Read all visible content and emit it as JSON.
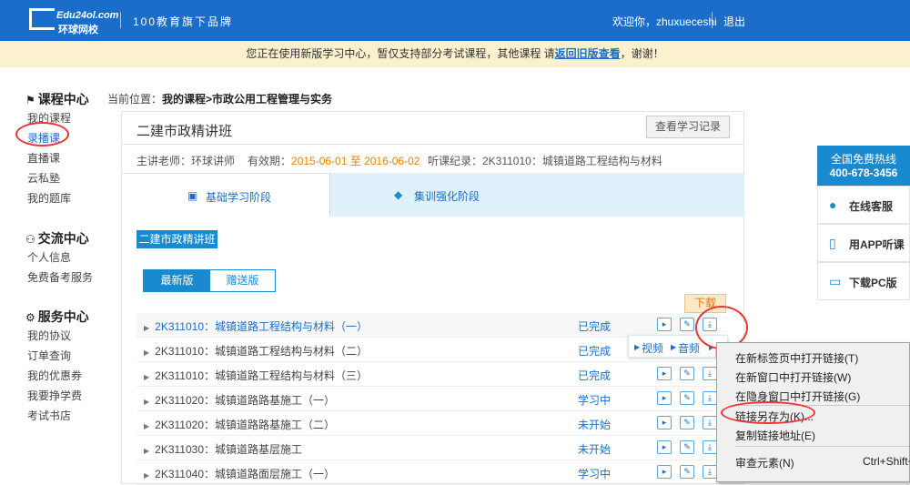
{
  "header": {
    "logo_line1": "Edu24ol.com",
    "logo_line2": "环球网校",
    "tagline": "100教育旗下品牌",
    "welcome": "欢迎你，zhuxueceshi",
    "logout": "退出"
  },
  "notice": {
    "prefix": "您正在使用新版学习中心，暂仅支持部分考试课程，其他课程 请",
    "link": "返回旧版查看",
    "suffix": "，谢谢！"
  },
  "sidebar": {
    "course_center": {
      "title": "课程中心",
      "items": [
        "我的课程",
        "录播课",
        "直播课",
        "云私塾",
        "我的题库"
      ]
    },
    "exchange_center": {
      "title": "交流中心",
      "items": [
        "个人信息",
        "免费备考服务"
      ]
    },
    "service_center": {
      "title": "服务中心",
      "items": [
        "我的协议",
        "订单查询",
        "我的优惠券",
        "我要挣学费",
        "考试书店"
      ]
    }
  },
  "breadcrumb": {
    "label": "当前位置：",
    "path": "我的课程>市政公用工程管理与实务"
  },
  "course": {
    "title": "二建市政精讲班",
    "record_button": "查看学习记录",
    "teacher": "主讲老师：环球讲师",
    "validity_label": "有效期：",
    "validity_dates": "2015-06-01 至 2016-06-02",
    "last_listen": "听课纪录：2K311010：城镇道路工程结构与材料",
    "stage_tabs": [
      "基础学习阶段",
      "集训强化阶段"
    ],
    "class_button": "二建市政精讲班",
    "version_tabs": [
      "最新版",
      "赠送版"
    ],
    "lessons": [
      {
        "title": "2K311010：城镇道路工程结构与材料（一）",
        "status": "已完成"
      },
      {
        "title": "2K311010：城镇道路工程结构与材料（二）",
        "status": "已完成"
      },
      {
        "title": "2K311010：城镇道路工程结构与材料（三）",
        "status": "已完成"
      },
      {
        "title": "2K311020：城镇道路路基施工（一）",
        "status": "学习中"
      },
      {
        "title": "2K311020：城镇道路路基施工（二）",
        "status": "未开始"
      },
      {
        "title": "2K311030：城镇道路基层施工",
        "status": "未开始"
      },
      {
        "title": "2K311040：城镇道路面层施工（一）",
        "status": "学习中"
      }
    ]
  },
  "download_tooltip": "下载",
  "sub_menu": {
    "video": "视频",
    "audio": "音频"
  },
  "context_menu": {
    "items": [
      "在新标签页中打开链接(T)",
      "在新窗口中打开链接(W)",
      "在隐身窗口中打开链接(G)",
      "链接另存为(K)...",
      "复制链接地址(E)",
      "审查元素(N)"
    ],
    "inspect_shortcut": "Ctrl+Shift+"
  },
  "right_panel": {
    "hotline_title": "全国免费热线",
    "hotline_number": "400-678-3456",
    "buttons": [
      "在线客服",
      "用APP听课",
      "下载PC版"
    ]
  }
}
